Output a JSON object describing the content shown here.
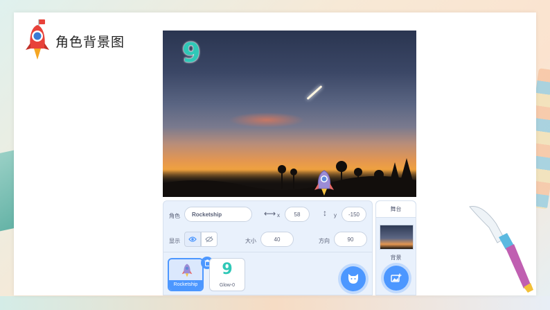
{
  "slide": {
    "title": "角色背景图"
  },
  "stage": {
    "glow_sprite_glyph": "9"
  },
  "sprite_info": {
    "sprite_label": "角色",
    "sprite_name": "Rocketship",
    "x_label": "x",
    "x_value": "58",
    "y_label": "y",
    "y_value": "-150",
    "show_label": "显示",
    "size_label": "大小",
    "size_value": "40",
    "direction_label": "方向",
    "direction_value": "90"
  },
  "sprites": [
    {
      "name": "Rocketship",
      "selected": true
    },
    {
      "name": "Glow-0",
      "selected": false,
      "glyph": "9"
    }
  ],
  "stage_pane": {
    "title": "舞台",
    "backdrops_label": "背景"
  },
  "colors": {
    "accent": "#4c97ff",
    "panel_bg": "#e9f1fc",
    "glow_teal": "#2fc8b7"
  },
  "icons": {
    "logo": "rocket-logo-icon",
    "x_arrow": "horizontal-arrow-icon",
    "y_arrow": "vertical-arrow-icon",
    "show": "eye-icon",
    "hide": "eye-off-icon",
    "delete": "trash-icon",
    "add_sprite": "cat-add-icon",
    "add_backdrop": "image-add-icon"
  }
}
